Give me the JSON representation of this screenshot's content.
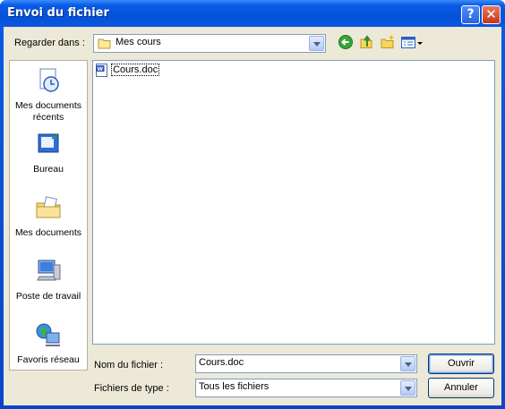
{
  "window": {
    "title": "Envoi du fichier",
    "help_glyph": "?",
    "close_glyph": "✕"
  },
  "look_in": {
    "label": "Regarder dans :",
    "value": "Mes cours"
  },
  "toolbar": {
    "back_icon": "back-arrow-icon",
    "up_icon": "up-folder-icon",
    "new_folder_icon": "new-folder-icon",
    "views_icon": "views-menu-icon"
  },
  "places": [
    {
      "label": "Mes documents récents",
      "icon": "recent-documents-icon"
    },
    {
      "label": "Bureau",
      "icon": "desktop-icon"
    },
    {
      "label": "Mes documents",
      "icon": "my-documents-icon"
    },
    {
      "label": "Poste de travail",
      "icon": "my-computer-icon"
    },
    {
      "label": "Favoris réseau",
      "icon": "network-places-icon"
    }
  ],
  "files": [
    {
      "name": "Cours.doc",
      "icon": "word-document-icon"
    }
  ],
  "filename": {
    "label": "Nom du fichier :",
    "value": "Cours.doc"
  },
  "filetype": {
    "label": "Fichiers de type :",
    "value": "Tous les fichiers"
  },
  "buttons": {
    "open": "Ouvrir",
    "cancel": "Annuler"
  },
  "colors": {
    "titlebar": "#0a5ae8",
    "client": "#ece9d8",
    "border": "#7f9db9"
  }
}
